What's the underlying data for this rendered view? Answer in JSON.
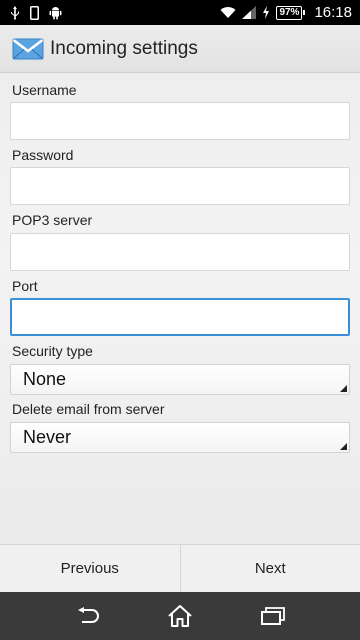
{
  "status_bar": {
    "left_icons": [
      "usb-icon",
      "phone-icon",
      "android-icon"
    ],
    "right_icons": [
      "wifi-icon",
      "signal-icon",
      "charging-icon"
    ],
    "battery": "97%",
    "time": "16:18"
  },
  "header": {
    "title": "Incoming settings",
    "icon": "email-envelope-icon"
  },
  "form": {
    "username": {
      "label": "Username",
      "value": ""
    },
    "password": {
      "label": "Password",
      "value": ""
    },
    "pop3_server": {
      "label": "POP3 server",
      "value": ""
    },
    "port": {
      "label": "Port",
      "value": ""
    },
    "security_type": {
      "label": "Security type",
      "value": "None"
    },
    "delete_email": {
      "label": "Delete email from server",
      "value": "Never"
    }
  },
  "actions": {
    "previous": "Previous",
    "next": "Next"
  },
  "nav_bar": {
    "icons": [
      "back-icon",
      "home-icon",
      "recent-apps-icon"
    ]
  },
  "colors": {
    "focus_border": "#3a8fd6",
    "nav_bar": "#3a3a3a"
  }
}
